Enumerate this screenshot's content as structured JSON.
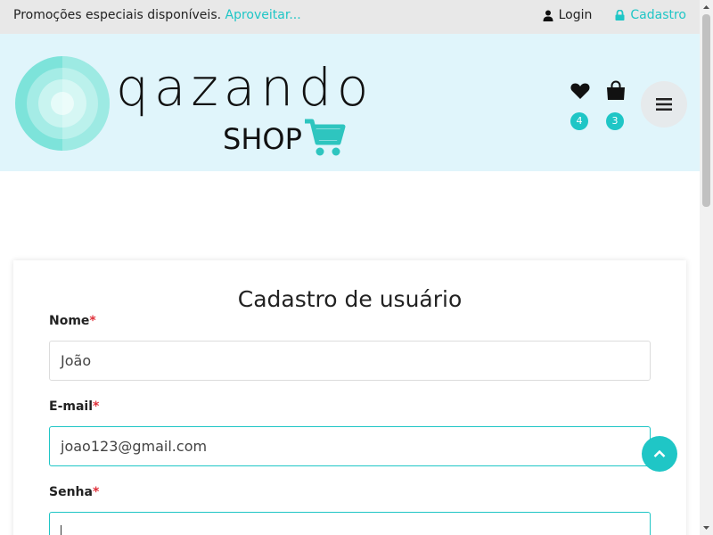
{
  "topbar": {
    "promo_text": "Promoções especiais disponíveis.",
    "promo_link": "Aproveitar...",
    "login_label": "Login",
    "cadastro_label": "Cadastro"
  },
  "header": {
    "logo_title": "qazando",
    "logo_sub": "SHOP",
    "wishlist_count": "4",
    "cart_count": "3"
  },
  "form": {
    "title": "Cadastro de usuário",
    "name_label": "Nome",
    "name_value": "João",
    "email_label": "E-mail",
    "email_value": "joao123@gmail.com",
    "password_label": "Senha",
    "password_value": "",
    "required_mark": "*"
  },
  "colors": {
    "accent": "#1fc6c6",
    "header_bg": "#e0f5fb",
    "topbar_bg": "#e8e8e8",
    "required": "#e0303a"
  },
  "icons": [
    "user-icon",
    "lock-icon",
    "heart-icon",
    "shopping-bag-icon",
    "menu-icon",
    "chevron-up-icon",
    "cart-icon"
  ]
}
